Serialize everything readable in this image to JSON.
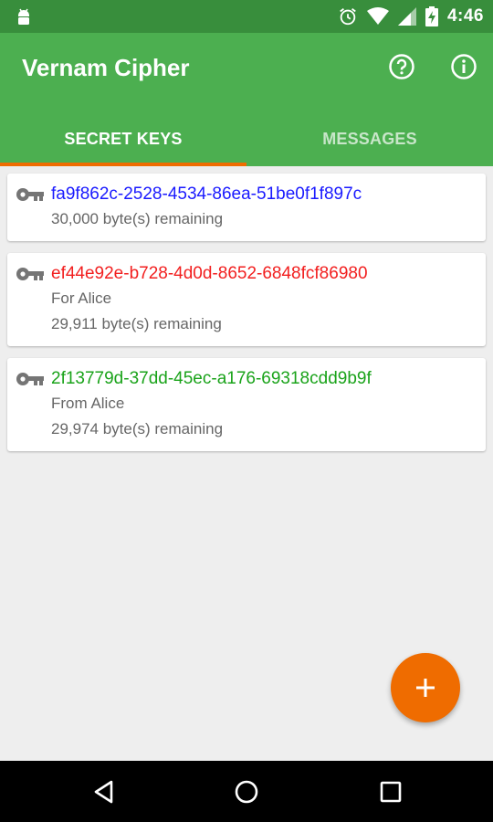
{
  "status_bar": {
    "time": "4:46",
    "icons": [
      "android-icon",
      "alarm-icon",
      "wifi-icon",
      "signal-icon",
      "battery-charging-icon"
    ]
  },
  "app_bar": {
    "title": "Vernam Cipher",
    "actions": [
      "help-icon",
      "info-icon"
    ]
  },
  "tabs": [
    {
      "label": "SECRET KEYS",
      "active": true
    },
    {
      "label": "MESSAGES",
      "active": false
    }
  ],
  "keys": [
    {
      "id": "fa9f862c-2528-4534-86ea-51be0f1f897c",
      "color": "#1a1aff",
      "note": "",
      "remaining": "30,000 byte(s) remaining"
    },
    {
      "id": "ef44e92e-b728-4d0d-8652-6848fcf86980",
      "color": "#f21f1f",
      "note": "For Alice",
      "remaining": "29,911 byte(s) remaining"
    },
    {
      "id": "2f13779d-37dd-45ec-a176-69318cdd9b9f",
      "color": "#1aa31a",
      "note": "From Alice",
      "remaining": "29,974 byte(s) remaining"
    }
  ],
  "fab": {
    "icon": "plus-icon"
  },
  "nav": [
    "back-icon",
    "home-icon",
    "recents-icon"
  ],
  "colors": {
    "primary": "#4caf50",
    "primary_dark": "#388e3c",
    "accent": "#ef6c00"
  }
}
